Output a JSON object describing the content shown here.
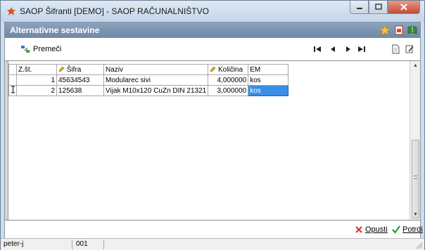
{
  "window": {
    "title": "SAOP Šifranti [DEMO] - SAOP RAČUNALNIŠTVO",
    "minimize_icon": "minimize-icon",
    "maximize_icon": "maximize-icon",
    "close_icon": "close-icon"
  },
  "header": {
    "title": "Alternativne sestavine",
    "icons": [
      "star-icon",
      "document-icon",
      "book-icon"
    ]
  },
  "toolbar": {
    "move_label": "Premeči",
    "nav_icons": [
      "first-record-icon",
      "previous-record-icon",
      "next-record-icon",
      "last-record-icon"
    ],
    "right_icons": [
      "new-document-icon",
      "edit-document-icon"
    ]
  },
  "grid": {
    "columns": [
      "Z.št.",
      "Šifra",
      "Naziv",
      "Količina",
      "EM"
    ],
    "rows": [
      {
        "zst": "1",
        "sifra": "45634543",
        "naziv": "Modularec sivi",
        "kolicina": "4,000000",
        "em": "kos"
      },
      {
        "zst": "2",
        "sifra": "125638",
        "naziv": "Vijak M10x120 CuZn DIN 21321",
        "kolicina": "3,000000",
        "em": "kos"
      }
    ]
  },
  "buttons": {
    "cancel": "Opusti",
    "confirm": "Potrdi"
  },
  "status": {
    "user": "peter-j",
    "code": "001"
  },
  "colors": {
    "header_bg": "#7a93b1",
    "selection": "#3a8ee6",
    "cancel_icon": "#d33a2c",
    "confirm_icon": "#2e9a2e"
  }
}
